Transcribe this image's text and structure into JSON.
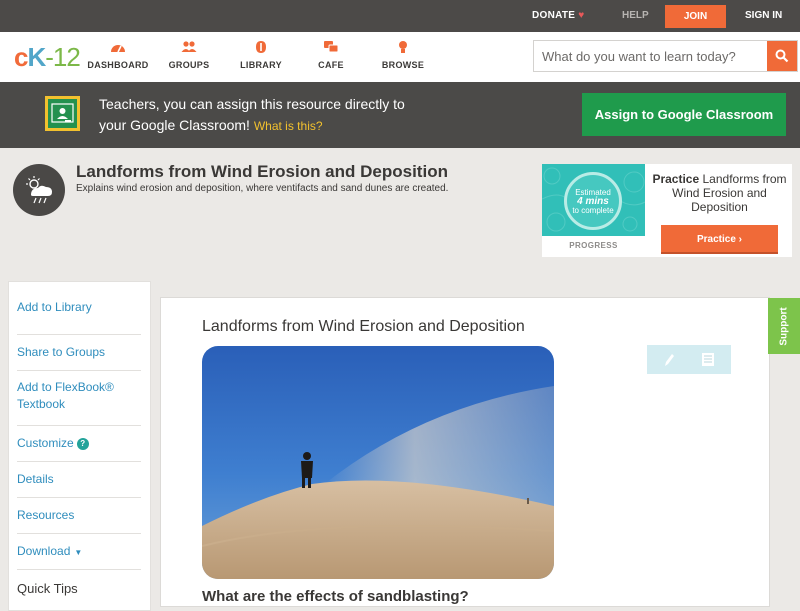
{
  "topbar": {
    "donate": "DONATE",
    "help": "HELP",
    "join": "JOIN",
    "signin": "SIGN IN"
  },
  "logo": {
    "c": "c",
    "k": "K",
    "rest": "-12"
  },
  "nav": [
    {
      "label": "DASHBOARD",
      "icon": "dashboard-icon"
    },
    {
      "label": "GROUPS",
      "icon": "groups-icon"
    },
    {
      "label": "LIBRARY",
      "icon": "library-icon"
    },
    {
      "label": "CAFE",
      "icon": "cafe-icon"
    },
    {
      "label": "BROWSE",
      "icon": "browse-icon"
    }
  ],
  "search": {
    "placeholder": "What do you want to learn today?"
  },
  "classroom": {
    "line1": "Teachers, you can assign this resource directly to",
    "line2": "your Google Classroom!",
    "what": "What is this?",
    "button": "Assign to Google Classroom"
  },
  "lesson": {
    "title": "Landforms from Wind Erosion and Deposition",
    "description": "Explains wind erosion and deposition, where ventifacts and sand dunes are created."
  },
  "practice": {
    "estimated": "Estimated",
    "mins": "4 mins",
    "to_complete": "to complete",
    "progress": "PROGRESS",
    "bold": "Practice",
    "text": "Landforms from Wind Erosion and Deposition",
    "button": "Practice"
  },
  "sidebar": {
    "items": [
      {
        "label": "Add to Library"
      },
      {
        "label": "Share to Groups"
      },
      {
        "label": "Add to FlexBook®",
        "label2": "Textbook"
      },
      {
        "label": "Customize"
      },
      {
        "label": "Details"
      },
      {
        "label": "Resources"
      },
      {
        "label": "Download"
      }
    ],
    "quicktips": "Quick Tips"
  },
  "content": {
    "title": "Landforms from Wind Erosion and Deposition",
    "question": "What are the effects of sandblasting?"
  },
  "support": "Support",
  "colors": {
    "accent": "#f06a38",
    "green": "#1f9b4c",
    "link": "#2f8dbd"
  }
}
